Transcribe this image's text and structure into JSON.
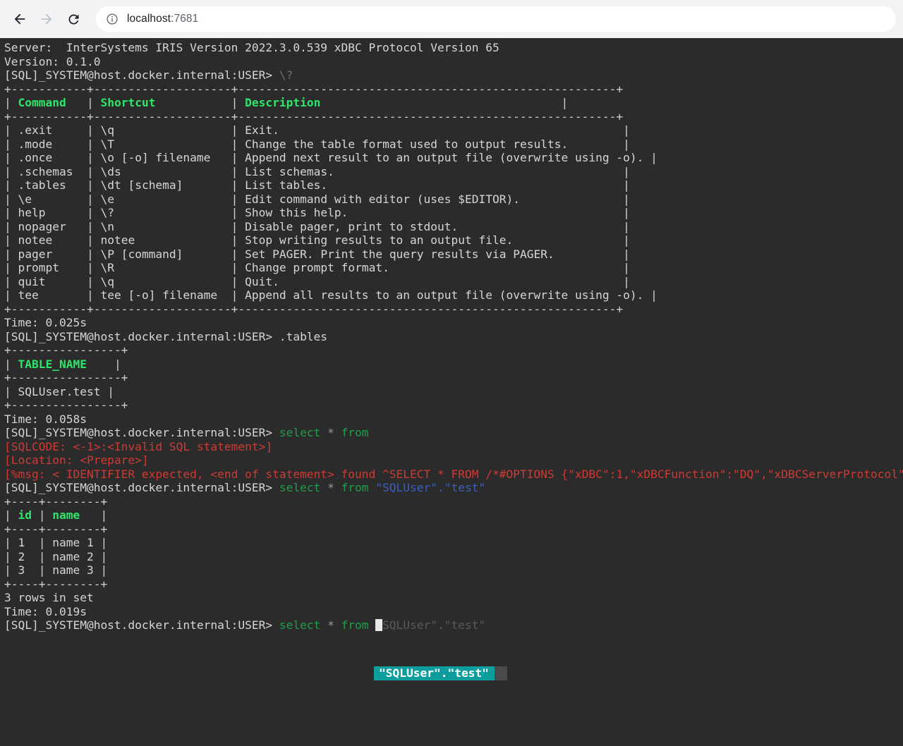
{
  "browser": {
    "back_label": "Back",
    "forward_label": "Forward",
    "reload_label": "Reload",
    "site_info_label": "View site information",
    "url_host": "localhost",
    "url_port": ":7681"
  },
  "terminal": {
    "server_line": "Server:  InterSystems IRIS Version 2022.3.0.539 xDBC Protocol Version 65",
    "version_line": "Version: 0.1.0",
    "prompt": "[SQL]_SYSTEM@host.docker.internal:USER> ",
    "help_command": "\\?",
    "help_table": {
      "rule_top": "+-----------+--------------------+-------------------------------------------------------+",
      "rule_header": "+-----------+--------------------+-------------------------------------------------------+",
      "rule_bottom": "+-----------+--------------------+-------------------------------------------------------+",
      "header": {
        "command": "Command",
        "shortcut": "Shortcut",
        "description": "Description"
      },
      "rows": [
        {
          "command": ".exit",
          "shortcut": "\\q",
          "description": "Exit."
        },
        {
          "command": ".mode",
          "shortcut": "\\T",
          "description": "Change the table format used to output results."
        },
        {
          "command": ".once",
          "shortcut": "\\o [-o] filename",
          "description": "Append next result to an output file (overwrite using -o)."
        },
        {
          "command": ".schemas",
          "shortcut": "\\ds",
          "description": "List schemas."
        },
        {
          "command": ".tables",
          "shortcut": "\\dt [schema]",
          "description": "List tables."
        },
        {
          "command": "\\e",
          "shortcut": "\\e",
          "description": "Edit command with editor (uses $EDITOR)."
        },
        {
          "command": "help",
          "shortcut": "\\?",
          "description": "Show this help."
        },
        {
          "command": "nopager",
          "shortcut": "\\n",
          "description": "Disable pager, print to stdout."
        },
        {
          "command": "notee",
          "shortcut": "notee",
          "description": "Stop writing results to an output file."
        },
        {
          "command": "pager",
          "shortcut": "\\P [command]",
          "description": "Set PAGER. Print the query results via PAGER."
        },
        {
          "command": "prompt",
          "shortcut": "\\R",
          "description": "Change prompt format."
        },
        {
          "command": "quit",
          "shortcut": "\\q",
          "description": "Quit."
        },
        {
          "command": "tee",
          "shortcut": "tee [-o] filename",
          "description": "Append all results to an output file (overwrite using -o)."
        }
      ]
    },
    "time_help": "Time: 0.025s",
    "tables_command": ".tables",
    "tables_result": {
      "rule": "+----------------+",
      "header": "TABLE_NAME",
      "header_pad": "   ",
      "rows": [
        "SQLUser.test"
      ]
    },
    "time_tables": "Time: 0.058s",
    "bad_query": {
      "keyword_select": "select",
      "star": "*",
      "keyword_from": "from",
      "error_lines": [
        "[SQLCODE: <-1>:<Invalid SQL statement>]",
        "[Location: <Prepare>]",
        "[%msg: < IDENTIFIER expected, <end of statement> found ^SELECT * FROM /*#OPTIONS {\"xDBC\":1,\"xDBCFunction\":\"DQ\",\"xDBCServerProtocol\""
      ]
    },
    "good_query": {
      "keyword_select": "select",
      "star": "*",
      "keyword_from": "from",
      "identifier": "\"SQLUser\".\"test\""
    },
    "select_result": {
      "rule": "+----+--------+",
      "headers": [
        "id",
        "name"
      ],
      "rows": [
        [
          "1",
          "name 1"
        ],
        [
          "2",
          "name 2"
        ],
        [
          "3",
          "name 3"
        ]
      ]
    },
    "rows_in_set": "3 rows in set",
    "time_select": "Time: 0.019s",
    "current_line": {
      "keyword_select": "select",
      "star": "*",
      "keyword_from": "from",
      "ghost_suggestion": "SQLUser\".\"test\""
    },
    "autocomplete": {
      "selected_item": "\"SQLUser\".\"test\""
    },
    "colors": {
      "background": "#2b2b2b",
      "foreground": "#d6d6d6",
      "keyword_green": "#2ee66b",
      "error_red": "#cf3a34",
      "identifier_blue": "#3b5fc0",
      "autocomplete_highlight": "#0e9d9d"
    }
  }
}
